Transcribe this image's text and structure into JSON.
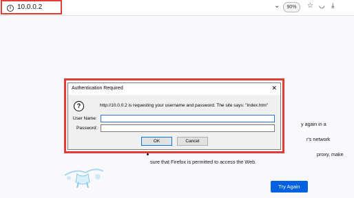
{
  "browser": {
    "url": "10.0.0.2",
    "zoom": "90%",
    "icons": [
      "info-icon",
      "chevron-down-icon",
      "save-pocket-icon",
      "download-icon",
      "star-icon"
    ]
  },
  "page": {
    "background_lines": [
      "y again in a",
      "r's network",
      "proxy, make",
      "sure that Firefox is permitted to access the Web."
    ],
    "try_again": "Try Again",
    "accent": "#0061e0"
  },
  "dialog": {
    "title": "Authentication Required",
    "message": "http://10.0.0.2 is requesting your username and password. The site says: \"index.htm\"",
    "username_label": "User Name:",
    "password_label": "Password:",
    "username_value": "",
    "password_value": "",
    "ok": "OK",
    "cancel": "Cancel"
  },
  "highlight_color": "#e53935"
}
